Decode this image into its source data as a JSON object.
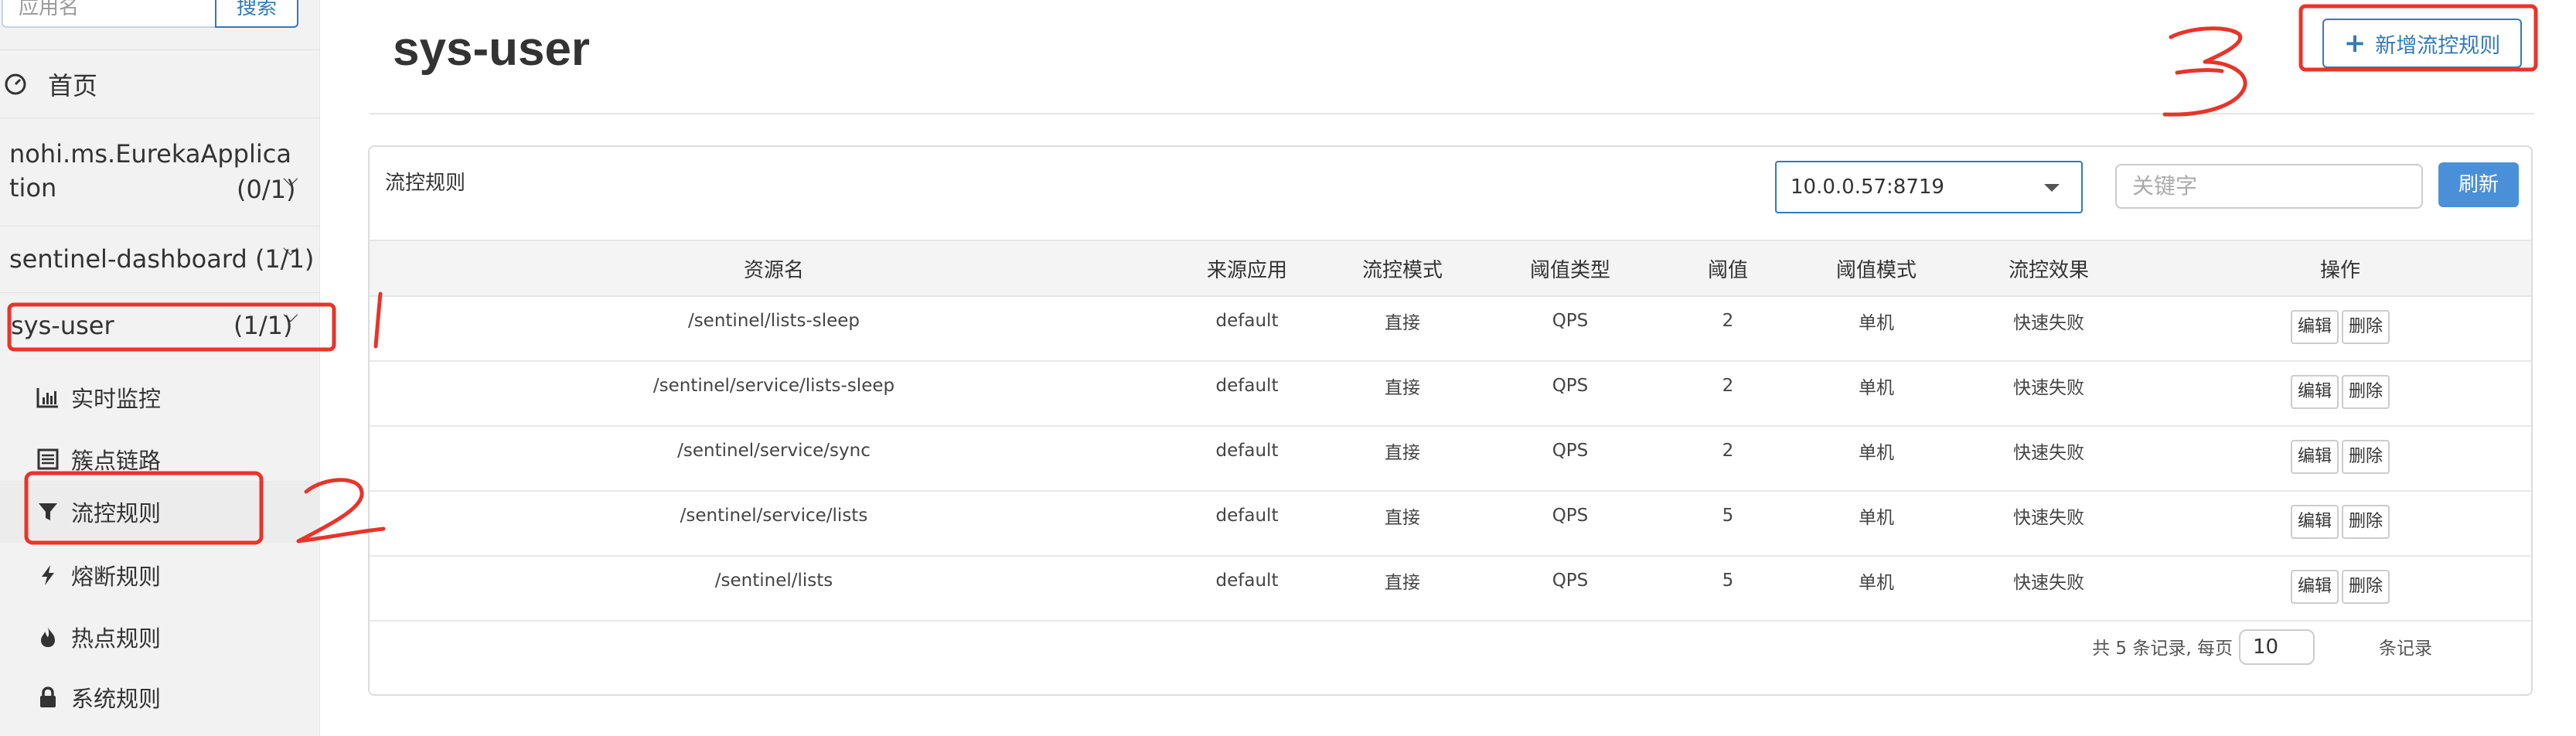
{
  "sidebar": {
    "search_placeholder": "应用名",
    "search_button": "搜索",
    "home_label": "首页",
    "apps": [
      {
        "name": "nohi.ms.EurekaApplication",
        "count": "(0/1)"
      },
      {
        "name": "sentinel-dashboard",
        "count": "(1/1)"
      },
      {
        "name": "sys-user",
        "count": "(1/1)"
      }
    ],
    "menu": [
      {
        "label": "实时监控",
        "icon": "bar-chart-icon"
      },
      {
        "label": "簇点链路",
        "icon": "list-icon"
      },
      {
        "label": "流控规则",
        "icon": "filter-icon"
      },
      {
        "label": "熔断规则",
        "icon": "bolt-icon"
      },
      {
        "label": "热点规则",
        "icon": "fire-icon"
      },
      {
        "label": "系统规则",
        "icon": "lock-icon"
      }
    ],
    "active_menu": "流控规则"
  },
  "header": {
    "title": "sys-user",
    "add_button": "新增流控规则"
  },
  "panel": {
    "title": "流控规则",
    "machine": "10.0.0.57:8719",
    "keyword_placeholder": "关键字",
    "refresh": "刷新",
    "columns": [
      "资源名",
      "来源应用",
      "流控模式",
      "阈值类型",
      "阈值",
      "阈值模式",
      "流控效果",
      "操作"
    ],
    "rows": [
      {
        "resource": "/sentinel/lists-sleep",
        "origin": "default",
        "mode": "直接",
        "grade": "QPS",
        "count": "2",
        "cluster": "单机",
        "effect": "快速失败"
      },
      {
        "resource": "/sentinel/service/lists-sleep",
        "origin": "default",
        "mode": "直接",
        "grade": "QPS",
        "count": "2",
        "cluster": "单机",
        "effect": "快速失败"
      },
      {
        "resource": "/sentinel/service/sync",
        "origin": "default",
        "mode": "直接",
        "grade": "QPS",
        "count": "2",
        "cluster": "单机",
        "effect": "快速失败"
      },
      {
        "resource": "/sentinel/service/lists",
        "origin": "default",
        "mode": "直接",
        "grade": "QPS",
        "count": "5",
        "cluster": "单机",
        "effect": "快速失败"
      },
      {
        "resource": "/sentinel/lists",
        "origin": "default",
        "mode": "直接",
        "grade": "QPS",
        "count": "5",
        "cluster": "单机",
        "effect": "快速失败"
      }
    ],
    "edit_label": "编辑",
    "delete_label": "删除",
    "pager_prefix": "共 5 条记录, 每页",
    "page_size": "10",
    "pager_suffix": "条记录"
  },
  "annotations": {
    "color": "#e8342a",
    "marks": [
      "1",
      "2",
      "3"
    ]
  }
}
